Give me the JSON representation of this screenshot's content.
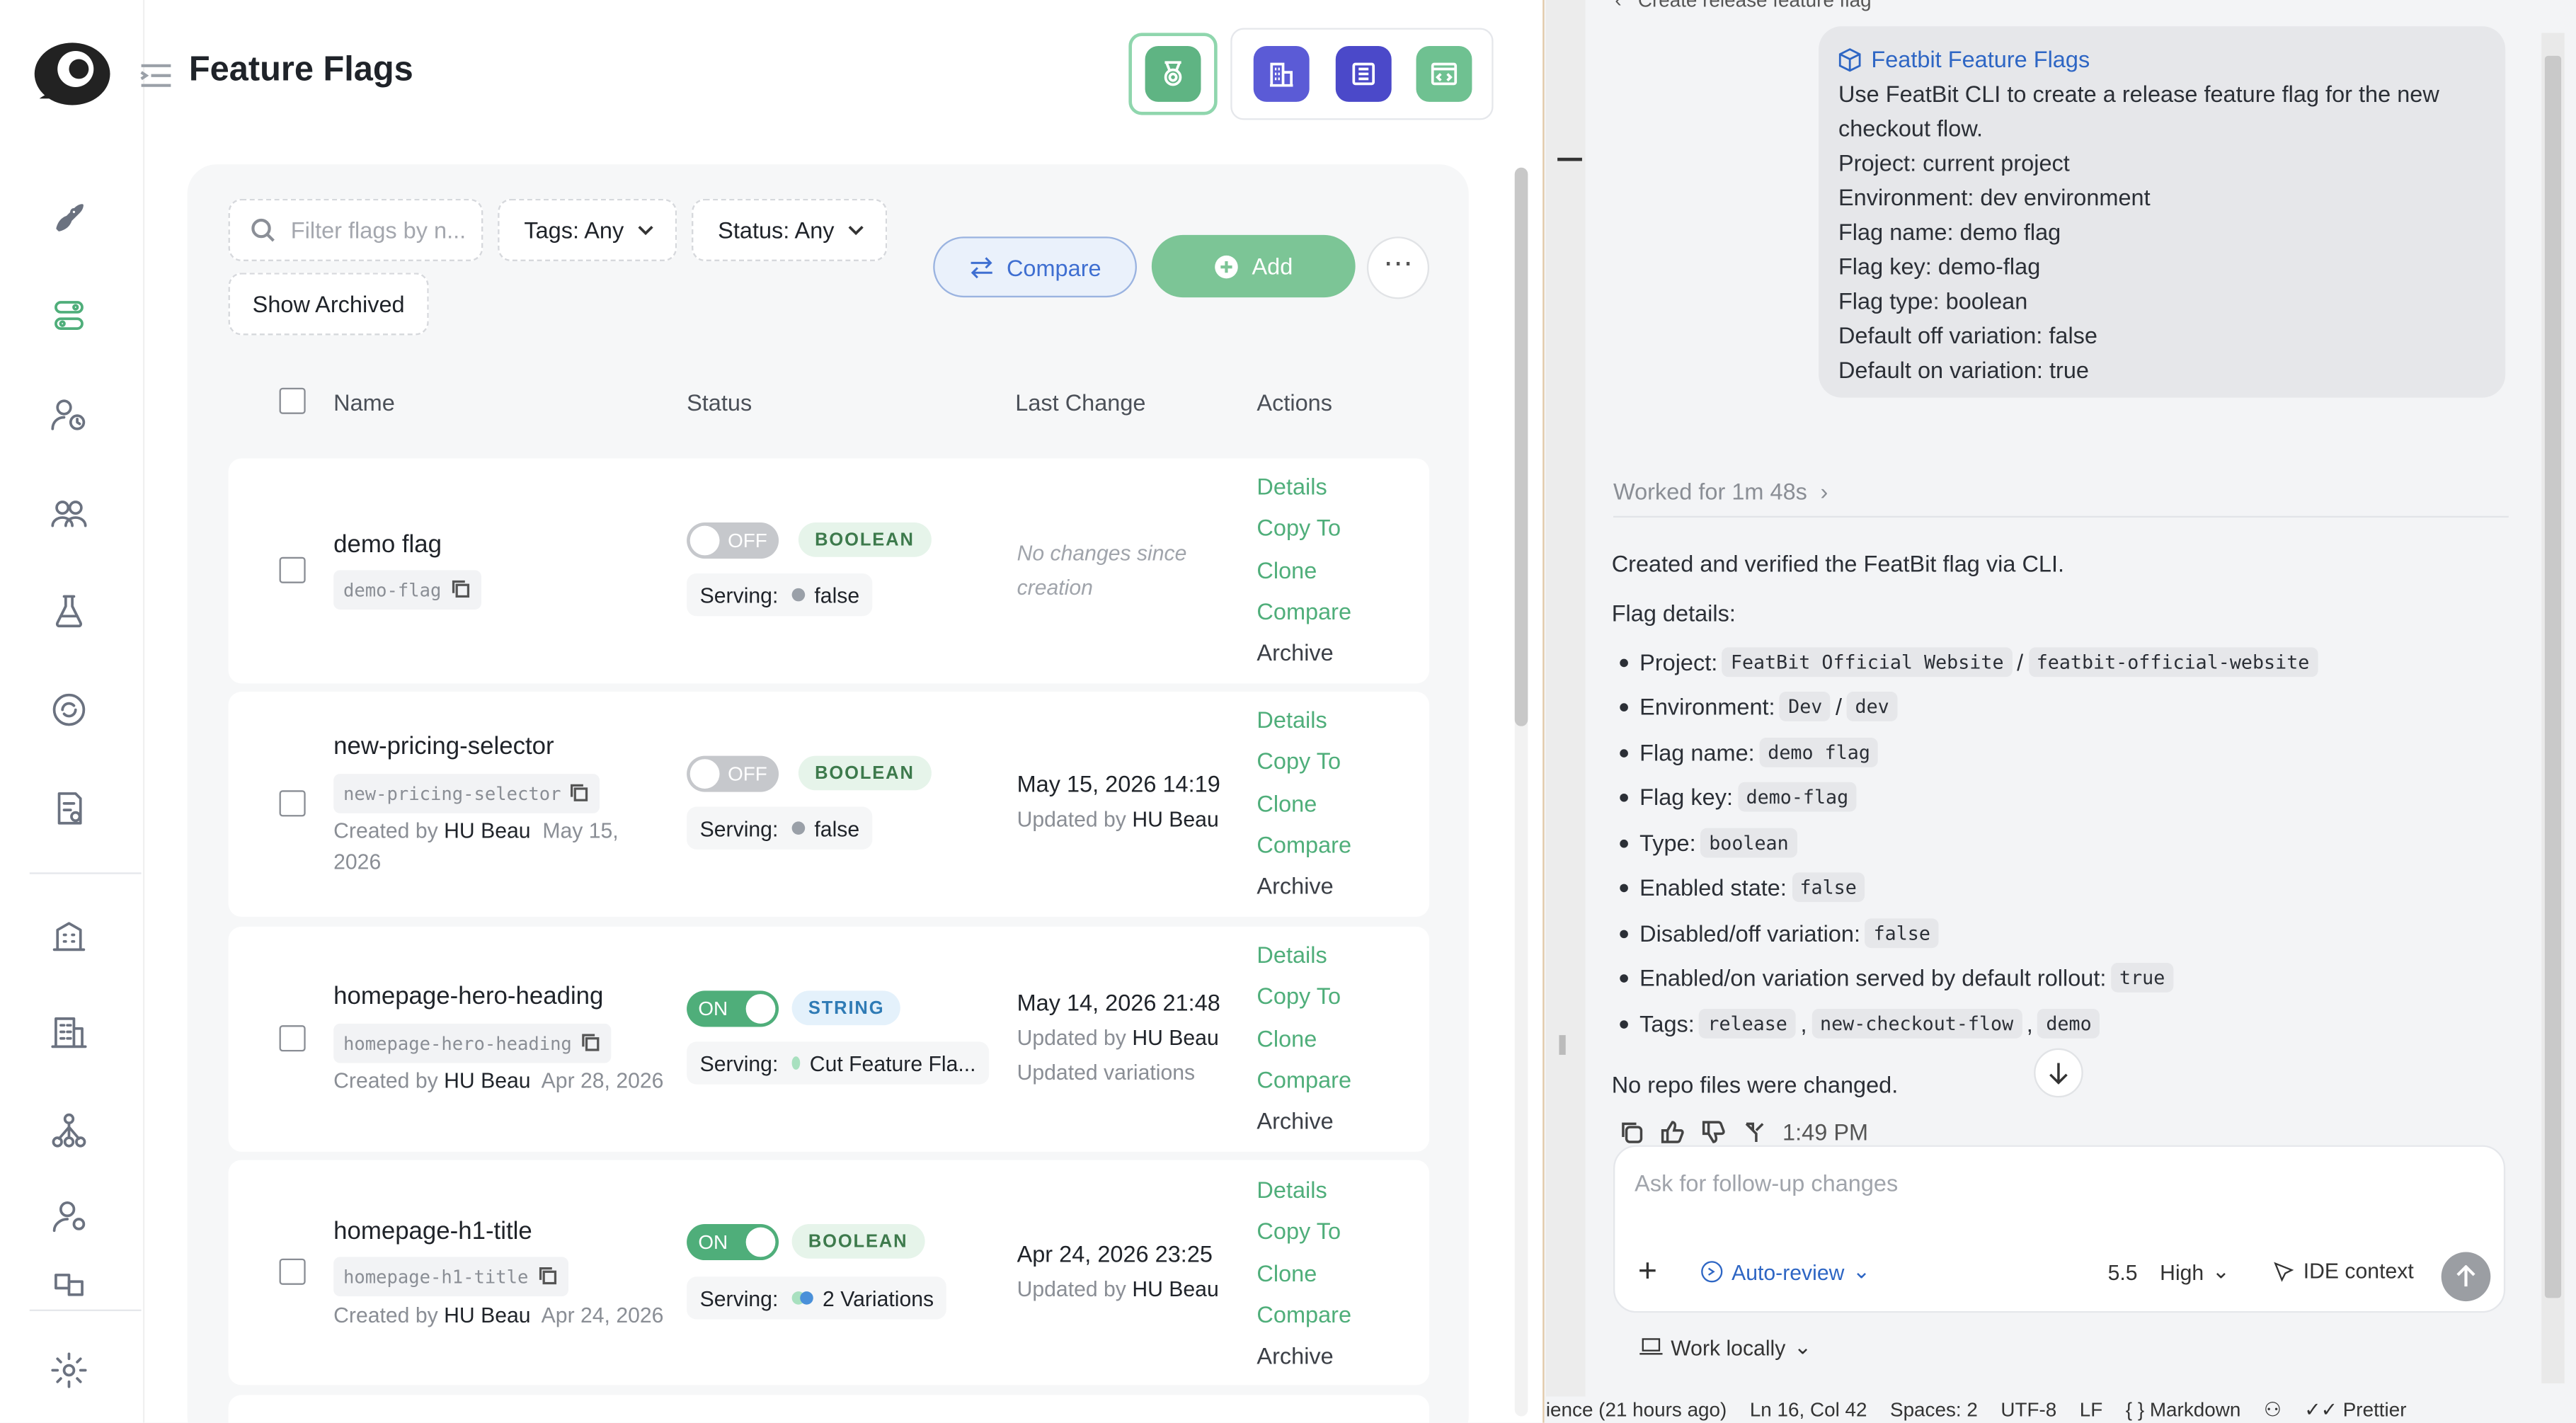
{
  "page": {
    "title": "Feature Flags"
  },
  "filters": {
    "search_placeholder": "Filter flags by n...",
    "tags": "Tags: Any",
    "status": "Status: Any",
    "show_archived": "Show Archived"
  },
  "buttons": {
    "compare": "Compare",
    "add": "Add",
    "more": "⋯"
  },
  "table": {
    "headers": [
      "Name",
      "Status",
      "Last Change",
      "Actions"
    ],
    "actions": [
      "Details",
      "Copy To",
      "Clone",
      "Compare",
      "Archive"
    ],
    "rows": [
      {
        "name": "demo flag",
        "key": "demo-flag",
        "created_label": "",
        "created_by": "",
        "created_date": "",
        "toggle": "OFF",
        "type": "BOOLEAN",
        "serving_label": "Serving:",
        "serving": "false",
        "change_date": "",
        "updated_label": "",
        "updated_by": "",
        "updated_extra": "",
        "no_change": "No changes since creation"
      },
      {
        "name": "new-pricing-selector",
        "key": "new-pricing-selector",
        "created_label": "Created by",
        "created_by": "HU Beau",
        "created_date": "May 15, 2026",
        "toggle": "OFF",
        "type": "BOOLEAN",
        "serving_label": "Serving:",
        "serving": "false",
        "change_date": "May 15, 2026 14:19",
        "updated_label": "Updated by",
        "updated_by": "HU Beau",
        "updated_extra": "",
        "no_change": ""
      },
      {
        "name": "homepage-hero-heading",
        "key": "homepage-hero-heading",
        "created_label": "Created by",
        "created_by": "HU Beau",
        "created_date": "Apr 28, 2026",
        "toggle": "ON",
        "type": "STRING",
        "serving_label": "Serving:",
        "serving": "Cut Feature Fla...",
        "change_date": "May 14, 2026 21:48",
        "updated_label": "Updated by",
        "updated_by": "HU Beau",
        "updated_extra": "Updated variations",
        "no_change": ""
      },
      {
        "name": "homepage-h1-title",
        "key": "homepage-h1-title",
        "created_label": "Created by",
        "created_by": "HU Beau",
        "created_date": "Apr 24, 2026",
        "toggle": "ON",
        "type": "BOOLEAN",
        "serving_label": "Serving:",
        "serving": "2 Variations",
        "change_date": "Apr 24, 2026 23:25",
        "updated_label": "Updated by",
        "updated_by": "HU Beau",
        "updated_extra": "",
        "no_change": ""
      }
    ]
  },
  "assistant": {
    "header_crumb": "Create release feature flag",
    "message_title": "Featbit Feature Flags",
    "message_lines": [
      "Use FeatBit CLI to create a release feature flag for the new",
      "checkout flow.",
      "Project: current project",
      "Environment: dev environment",
      "Flag name: demo flag",
      "Flag key: demo-flag",
      "Flag type: boolean",
      "Default off variation: false",
      "Default on variation: true"
    ],
    "worked": "Worked for 1m 48s",
    "summary": "Created and verified the FeatBit flag via CLI.",
    "details_label": "Flag details:",
    "details": [
      {
        "label": "Project:",
        "codes": [
          "FeatBit Official Website",
          "featbit-official-website"
        ],
        "sep": "/"
      },
      {
        "label": "Environment:",
        "codes": [
          "Dev",
          "dev"
        ],
        "sep": "/"
      },
      {
        "label": "Flag name:",
        "codes": [
          "demo flag"
        ],
        "sep": ""
      },
      {
        "label": "Flag key:",
        "codes": [
          "demo-flag"
        ],
        "sep": ""
      },
      {
        "label": "Type:",
        "codes": [
          "boolean"
        ],
        "sep": ""
      },
      {
        "label": "Enabled state:",
        "codes": [
          "false"
        ],
        "sep": ""
      },
      {
        "label": "Disabled/off variation:",
        "codes": [
          "false"
        ],
        "sep": ""
      },
      {
        "label": "Enabled/on variation served by default rollout:",
        "codes": [
          "true"
        ],
        "sep": ""
      },
      {
        "label": "Tags:",
        "codes": [
          "release",
          "new-checkout-flow",
          "demo"
        ],
        "sep": ","
      }
    ],
    "no_repo": "No repo files were changed.",
    "time": "1:49 PM",
    "composer_placeholder": "Ask for follow-up changes",
    "auto_review": "Auto-review",
    "model": "5.5",
    "effort": "High",
    "ide_context": "IDE context",
    "work_locally": "Work locally"
  },
  "statusbar": {
    "items": [
      "ience (21 hours ago)",
      "Ln 16, Col 42",
      "Spaces: 2",
      "UTF-8",
      "LF",
      "{ } Markdown",
      "Prettier"
    ]
  },
  "colors": {
    "accent_green": "#4fae7a",
    "add_button": "#7cc596",
    "link_blue": "#2e66c4",
    "top_purple": "#5b5bd6"
  }
}
